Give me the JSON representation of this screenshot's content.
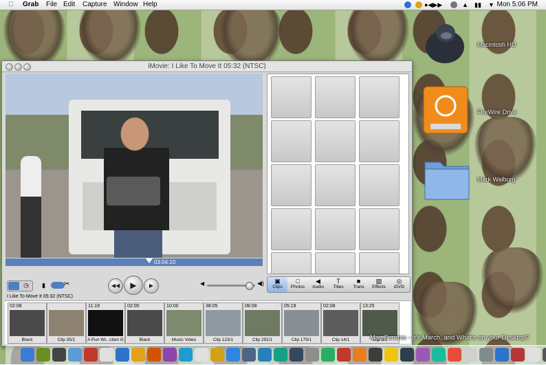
{
  "menubar": {
    "apple": "",
    "app_name": "Grab",
    "menus": [
      "File",
      "Edit",
      "Capture",
      "Window",
      "Help"
    ],
    "clock": "Mon 5:06 PM"
  },
  "desktop_icons": [
    {
      "label": "Macintosh HD",
      "icon": "gorilla-hd-icon"
    },
    {
      "label": "FireWire Drive",
      "icon": "firewire-drive-icon"
    },
    {
      "label": "Mark Walburg",
      "icon": "folder-icon"
    }
  ],
  "window": {
    "title": "iMovie: I Like To Move It  05:32 (NTSC)",
    "timecode": "03:04:10",
    "project_label": "I Like To Move It  05:32 (NTSC)",
    "volume_level": 0.85,
    "playhead_position": 0.56
  },
  "panes": [
    {
      "label": "Clips",
      "icon": "clips-icon",
      "selected": true
    },
    {
      "label": "Photos",
      "icon": "photos-icon"
    },
    {
      "label": "Audio",
      "icon": "audio-icon"
    },
    {
      "label": "Titles",
      "icon": "titles-icon"
    },
    {
      "label": "Trans",
      "icon": "transitions-icon"
    },
    {
      "label": "Effects",
      "icon": "effects-icon"
    },
    {
      "label": "iDVD",
      "icon": "idvd-icon"
    }
  ],
  "clips": [
    {
      "duration": "02:08",
      "name": "Black",
      "color": "#4a4a4a"
    },
    {
      "duration": "",
      "name": "Clip 35/1",
      "color": "#8d8271"
    },
    {
      "duration": "11:19",
      "name": "A Pun Wi...ction G",
      "color": "#111111"
    },
    {
      "duration": "02:00",
      "name": "Black",
      "color": "#4a4a4a"
    },
    {
      "duration": "10:00",
      "name": "Music Video",
      "color": "#7d8a6e"
    },
    {
      "duration": "38:05",
      "name": "Clip 123/1",
      "color": "#8f9aa0"
    },
    {
      "duration": "08:08",
      "name": "Clip 292/1",
      "color": "#6f7a63"
    },
    {
      "duration": "05:19",
      "name": "Clip 179/1",
      "color": "#8a8f94"
    },
    {
      "duration": "02:08",
      "name": "Clip 14/1",
      "color": "#5c5c5c"
    },
    {
      "duration": "13:25",
      "name": "Clip 8/1",
      "color": "#4f5a4a"
    }
  ],
  "ticker": "Mac Forums - It's March, and What's on your Desktop?",
  "colors": {
    "scrubber": "#5b7fb8",
    "pane_selected": "#8fb4e6",
    "window_bg": "#d9d9d9"
  }
}
